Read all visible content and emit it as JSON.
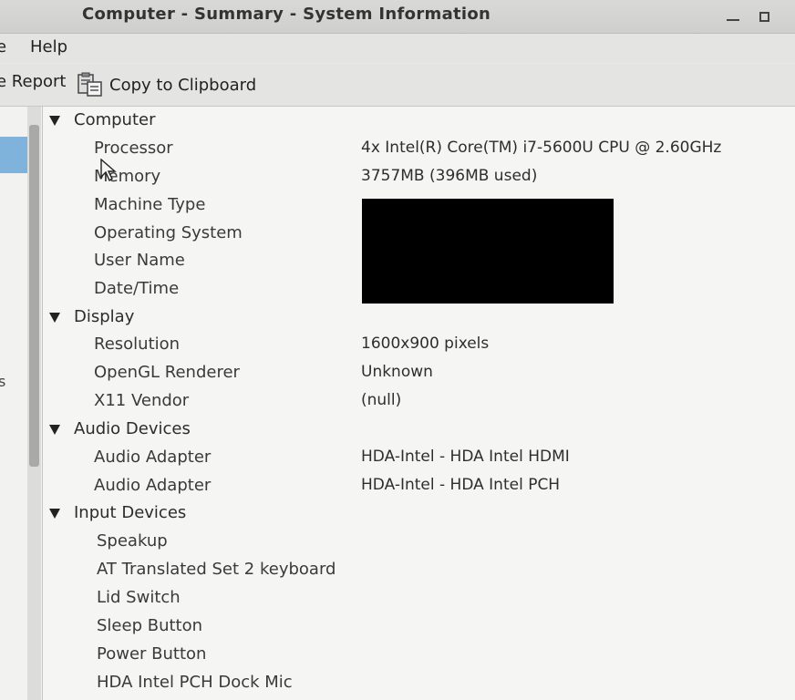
{
  "window": {
    "title": "Computer - Summary - System Information"
  },
  "menu": {
    "file_label": "e",
    "help_label": "Help"
  },
  "toolbar": {
    "report_label": "e Report",
    "copy_label": "Copy to Clipboard"
  },
  "sidebar": {
    "fragment_label": "s"
  },
  "tree": {
    "sections": [
      {
        "label": "Computer",
        "rows": [
          {
            "key": "Processor",
            "value": "4x Intel(R) Core(TM) i7-5600U CPU @ 2.60GHz"
          },
          {
            "key": "Memory",
            "value": "3757MB (396MB used)"
          },
          {
            "key": "Machine Type",
            "value": ""
          },
          {
            "key": "Operating System",
            "value": ""
          },
          {
            "key": "User Name",
            "value": ""
          },
          {
            "key": "Date/Time",
            "value": ""
          }
        ]
      },
      {
        "label": "Display",
        "rows": [
          {
            "key": "Resolution",
            "value": "1600x900 pixels"
          },
          {
            "key": "OpenGL Renderer",
            "value": "Unknown"
          },
          {
            "key": "X11 Vendor",
            "value": "(null)"
          }
        ]
      },
      {
        "label": "Audio Devices",
        "rows": [
          {
            "key": "Audio Adapter",
            "value": "HDA-Intel - HDA Intel HDMI"
          },
          {
            "key": "Audio Adapter",
            "value": "HDA-Intel - HDA Intel PCH"
          }
        ]
      },
      {
        "label": "Input Devices",
        "rows": [
          {
            "key": "Speakup",
            "value": ""
          },
          {
            "key": "AT Translated Set 2 keyboard",
            "value": ""
          },
          {
            "key": "Lid Switch",
            "value": ""
          },
          {
            "key": "Sleep Button",
            "value": ""
          },
          {
            "key": "Power Button",
            "value": ""
          },
          {
            "key": "HDA Intel PCH Dock Mic",
            "value": ""
          }
        ]
      }
    ]
  }
}
